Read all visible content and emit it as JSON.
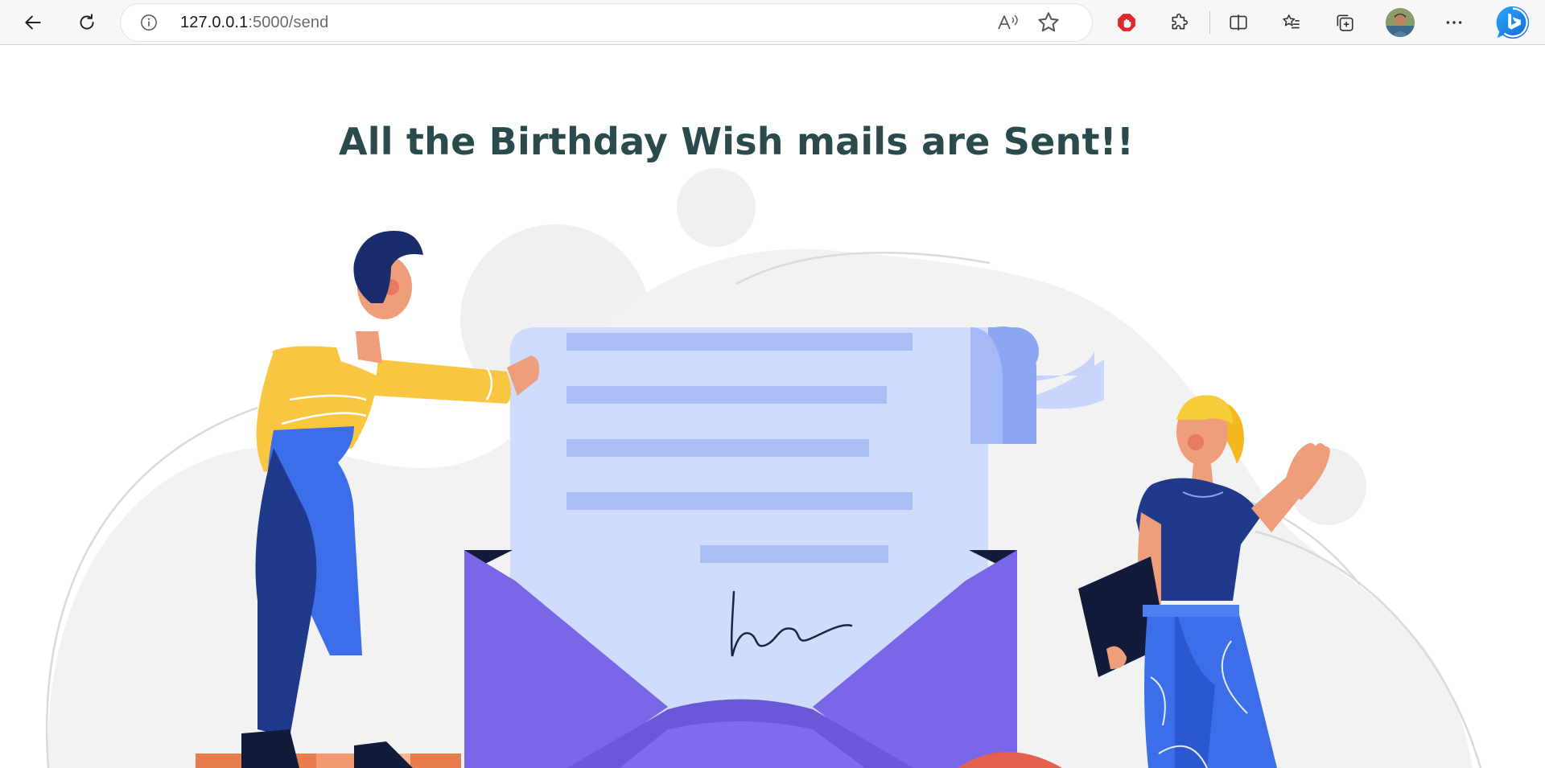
{
  "browser": {
    "url_host": "127.0.0.1",
    "url_rest": ":5000/send",
    "buttons": {
      "back": "back-arrow-icon",
      "refresh": "refresh-icon",
      "site_info": "info-icon",
      "read_aloud": "read-aloud-icon",
      "favorite": "star-icon",
      "adblock": "adblock-icon",
      "extensions": "puzzle-icon",
      "split_screen": "split-screen-icon",
      "favorites": "favorites-list-icon",
      "collections": "collections-icon",
      "profile": "avatar",
      "more": "more-icon",
      "copilot": "bing-icon"
    }
  },
  "page": {
    "headline": "All the Birthday Wish mails are Sent!!",
    "illustration": "birthday-mail-sent-illustration"
  },
  "colors": {
    "headline": "#2a4a4b",
    "letter": "#cfdcfb",
    "letter_lines": "#a9bef5",
    "envelope": "#7f6cec",
    "shirt_man": "#f9c641",
    "pants_blue": "#3b6ee8",
    "navy": "#1f3a8a",
    "skin": "#ee9e7a"
  }
}
